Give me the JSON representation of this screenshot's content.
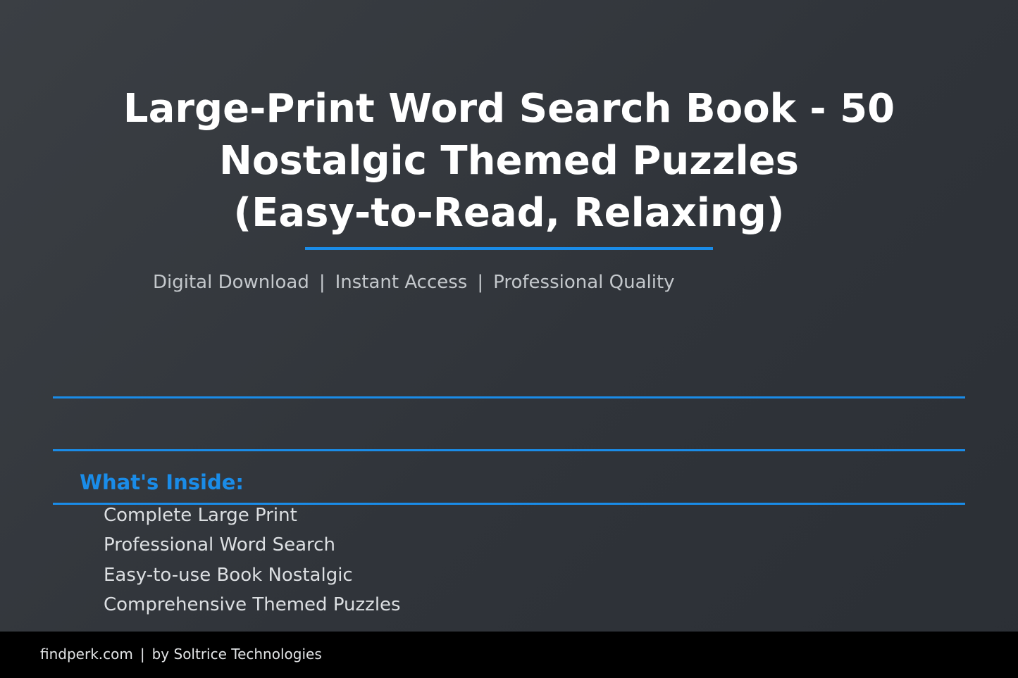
{
  "hero": {
    "title_lines": [
      "Large-Print Word Search Book - 50",
      "Nostalgic Themed Puzzles",
      "(Easy-to-Read, Relaxing)"
    ],
    "subtitle": {
      "items": [
        "Digital Download",
        "Instant Access",
        "Professional Quality"
      ],
      "separator": "|"
    }
  },
  "features": {
    "heading": "What's Inside:",
    "items": [
      "Complete Large Print",
      "Professional Word Search",
      "Easy-to-use Book Nostalgic",
      "Comprehensive Themed Puzzles"
    ]
  },
  "footer": {
    "site": "findperk.com",
    "separator": "|",
    "credit": "by Soltrice Technologies"
  },
  "colors": {
    "accent": "#1a8ce8",
    "background": "#33373c",
    "footer_background": "#000000",
    "title_text": "#ffffff",
    "subtitle_text": "#c4c8cc"
  }
}
